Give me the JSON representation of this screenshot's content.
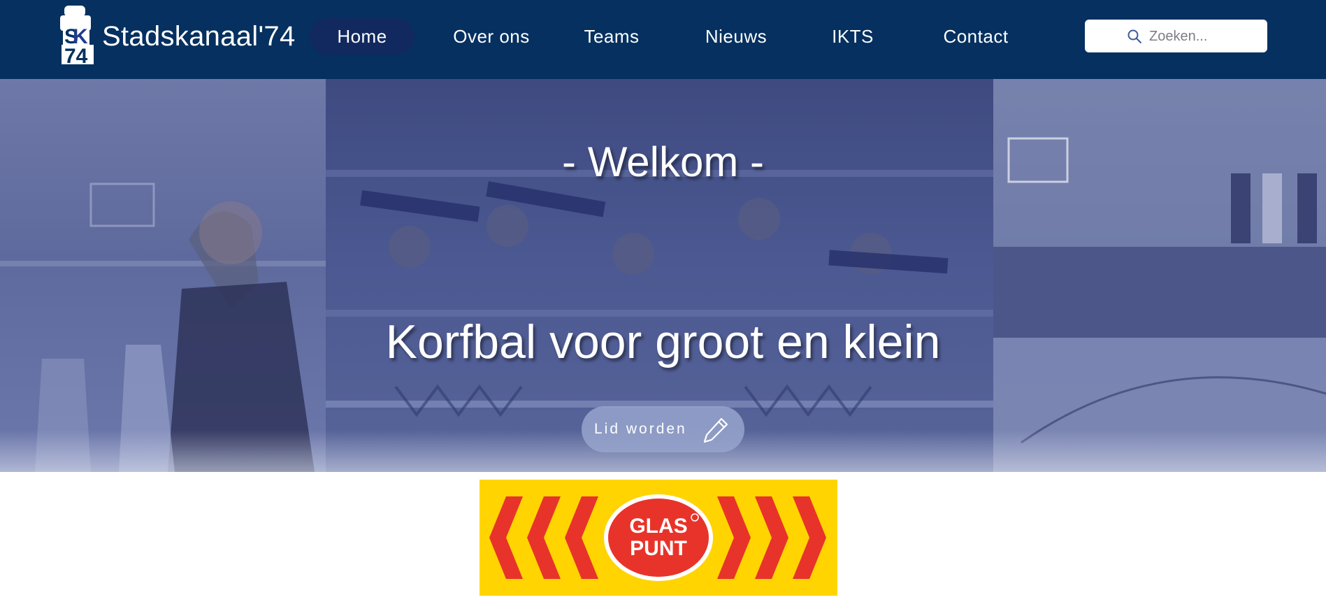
{
  "header": {
    "brand": "Stadskanaal'74",
    "logo_icon": "club-crest-icon",
    "nav": [
      {
        "label": "Home",
        "active": true
      },
      {
        "label": "Over ons",
        "active": false
      },
      {
        "label": "Teams",
        "active": false
      },
      {
        "label": "Nieuws",
        "active": false
      },
      {
        "label": "IKTS",
        "active": false
      },
      {
        "label": "Contact",
        "active": false
      }
    ],
    "search": {
      "placeholder": "Zoeken...",
      "value": "",
      "icon": "search-icon"
    }
  },
  "hero": {
    "welcome": "- Welkom -",
    "tagline": "Korfbal voor groot en klein",
    "cta": {
      "label": "Lid worden",
      "icon": "pencil-icon"
    }
  },
  "sponsor": {
    "logo_text": "GLAS PUNT",
    "colors": {
      "background": "#ffd400",
      "chevrons": "#e8332a",
      "badge": "#e8332a"
    }
  },
  "colors": {
    "header": "#05305f",
    "active_nav": "#12295f",
    "hero_tint": "#4f5e9a"
  }
}
